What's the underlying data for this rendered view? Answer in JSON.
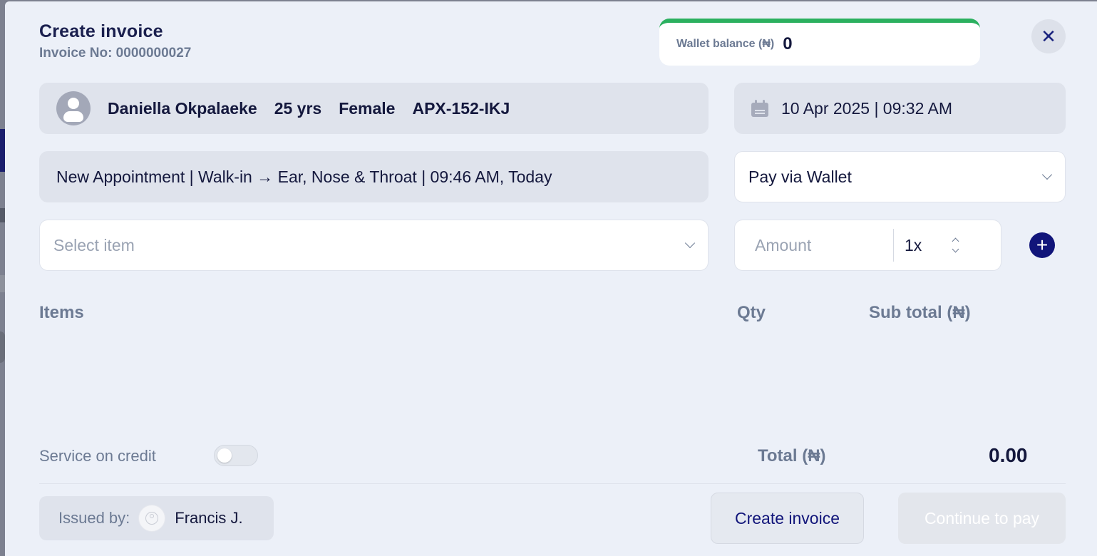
{
  "header": {
    "title": "Create invoice",
    "invoice_no": "Invoice No: 0000000027",
    "close_symbol": "✕"
  },
  "wallet": {
    "label": "Wallet balance (₦)",
    "value": "0",
    "accent_color": "#2bb05f"
  },
  "patient": {
    "name": "Daniella Okpalaeke",
    "age": "25 yrs",
    "gender": "Female",
    "id": "APX-152-IKJ"
  },
  "date": {
    "value": "10 Apr 2025 | 09:32 AM",
    "icon": "calendar-icon"
  },
  "appointment": {
    "text": "New Appointment | Walk-in → Ear, Nose & Throat | 09:46 AM, Today"
  },
  "payment": {
    "method": "Pay via Wallet"
  },
  "item_entry": {
    "select_placeholder": "Select item",
    "amount_placeholder": "Amount",
    "quantity": "1x",
    "add_symbol": "+"
  },
  "table": {
    "headers": {
      "items": "Items",
      "qty": "Qty",
      "subtotal": "Sub total (₦)"
    },
    "rows": []
  },
  "credit": {
    "label": "Service on credit",
    "enabled": false
  },
  "totals": {
    "label": "Total (₦)",
    "value": "0.00"
  },
  "footer": {
    "issued_label": "Issued by:",
    "issuer_name": "Francis J.",
    "create_label": "Create invoice",
    "continue_label": "Continue to pay"
  },
  "colors": {
    "primary": "#11157a",
    "text": "#14183d",
    "muted": "#6c7a93",
    "background": "#ecf0f8"
  }
}
